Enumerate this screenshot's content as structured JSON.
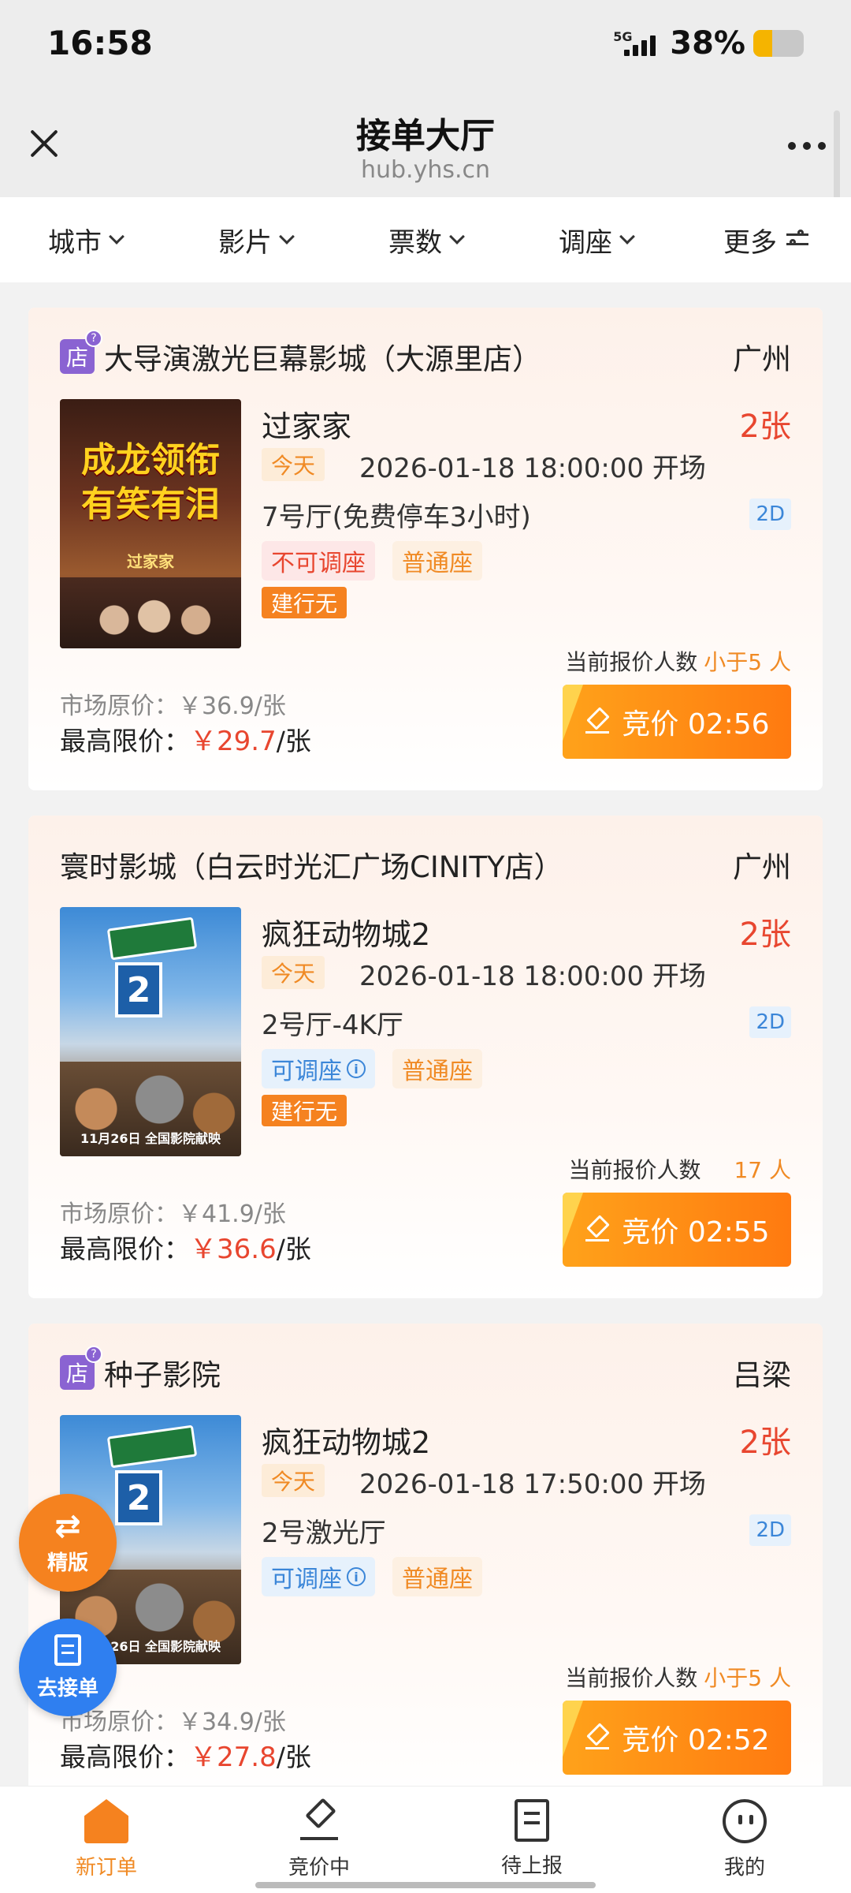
{
  "status_bar": {
    "time": "16:58",
    "network": "5G",
    "battery": "38%"
  },
  "header": {
    "title": "接单大厅",
    "subtitle": "hub.yhs.cn"
  },
  "filters": [
    {
      "label": "城市"
    },
    {
      "label": "影片"
    },
    {
      "label": "票数"
    },
    {
      "label": "调座"
    },
    {
      "label": "更多"
    }
  ],
  "orders": [
    {
      "store_badge": "店",
      "store_badge_help": "?",
      "cinema": "大导演激光巨幕影城（大源里店）",
      "city": "广州",
      "poster_text": "成龙领衔\n有笑有泪",
      "poster_subtitle": "过家家",
      "movie": "过家家",
      "tickets": "2张",
      "day_tag": "今天",
      "showtime": "2026-01-18 18:00:00 开场",
      "hall": "7号厅(免费停车3小时)",
      "format": "2D",
      "seat_tag": "不可调座",
      "seat_type": "普通座",
      "bank_tag": "建行无",
      "bidders_label": "当前报价人数",
      "bidders_count": "小于5 人",
      "market_price": "市场原价：￥36.9/张",
      "max_price_label": "最高限价：",
      "max_price_value": "￥29.7",
      "max_price_unit": "/张",
      "bid_label": "竞价 02:56"
    },
    {
      "cinema": "寰时影城（白云时光汇广场CINITY店）",
      "city": "广州",
      "poster_date": "11月26日 全国影院献映",
      "movie": "疯狂动物城2",
      "tickets": "2张",
      "day_tag": "今天",
      "showtime": "2026-01-18 18:00:00 开场",
      "hall": "2号厅-4K厅",
      "format": "2D",
      "seat_tag": "可调座",
      "seat_type": "普通座",
      "bank_tag": "建行无",
      "bidders_label": "当前报价人数",
      "bidders_count": "17 人",
      "market_price": "市场原价：￥41.9/张",
      "max_price_label": "最高限价：",
      "max_price_value": "￥36.6",
      "max_price_unit": "/张",
      "bid_label": "竞价 02:55"
    },
    {
      "store_badge": "店",
      "store_badge_help": "?",
      "cinema": "种子影院",
      "city": "吕梁",
      "poster_date": "11月26日 全国影院献映",
      "movie": "疯狂动物城2",
      "tickets": "2张",
      "day_tag": "今天",
      "showtime": "2026-01-18 17:50:00 开场",
      "hall": "2号激光厅",
      "format": "2D",
      "seat_tag": "可调座",
      "seat_type": "普通座",
      "bidders_label": "当前报价人数",
      "bidders_count": "小于5 人",
      "market_price": "市场原价：￥34.9/张",
      "max_price_label": "最高限价：",
      "max_price_value": "￥27.8",
      "max_price_unit": "/张",
      "bid_label": "竞价 02:52"
    }
  ],
  "fabs": {
    "switch_label": "精版",
    "switch_icon": "⇄",
    "take_order_label": "去接单"
  },
  "bottom_nav": [
    {
      "label": "新订单"
    },
    {
      "label": "竞价中"
    },
    {
      "label": "待上报"
    },
    {
      "label": "我的"
    }
  ],
  "colors": {
    "accent": "#f5821f",
    "price_red": "#e8462f",
    "link_blue": "#2f7ff0",
    "store_purple": "#8a63d2"
  }
}
